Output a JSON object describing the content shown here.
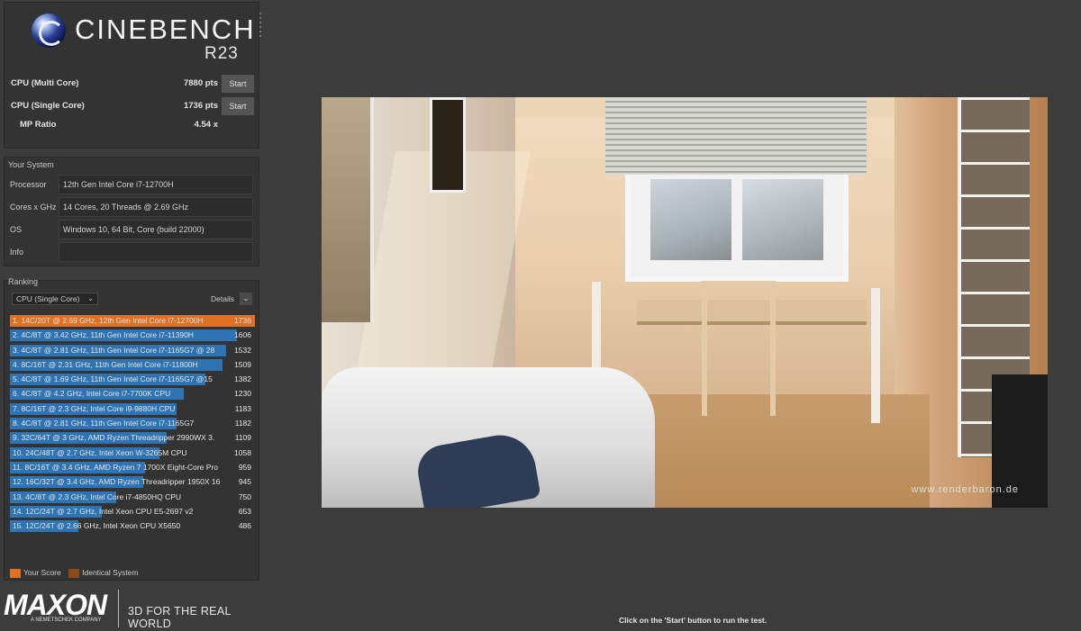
{
  "app": {
    "title": "CINEBENCH",
    "version": "R23"
  },
  "scores": {
    "multi": {
      "label": "CPU (Multi Core)",
      "value": "7880 pts",
      "button": "Start"
    },
    "single": {
      "label": "CPU (Single Core)",
      "value": "1736 pts",
      "button": "Start"
    },
    "ratio": {
      "label": "MP Ratio",
      "value": "4.54 x"
    }
  },
  "system": {
    "title": "Your System",
    "rows": [
      {
        "key": "Processor",
        "value": "12th Gen Intel Core i7-12700H"
      },
      {
        "key": "Cores x GHz",
        "value": "14 Cores, 20 Threads @ 2.69 GHz"
      },
      {
        "key": "OS",
        "value": "Windows 10, 64 Bit, Core (build 22000)"
      },
      {
        "key": "Info",
        "value": ""
      }
    ]
  },
  "ranking": {
    "title": "Ranking",
    "select": "CPU (Single Core)",
    "details_label": "Details",
    "max_score": 1736,
    "rows": [
      {
        "text": "1. 14C/20T @ 2.69 GHz, 12th Gen Intel Core i7-12700H",
        "score": 1736,
        "me": true
      },
      {
        "text": "2. 4C/8T @ 3.42 GHz, 11th Gen Intel Core i7-11390H",
        "score": 1606,
        "me": false
      },
      {
        "text": "3. 4C/8T @ 2.81 GHz, 11th Gen Intel Core i7-1165G7 @ 28",
        "score": 1532,
        "me": false
      },
      {
        "text": "4. 8C/16T @ 2.31 GHz, 11th Gen Intel Core i7-11800H",
        "score": 1509,
        "me": false
      },
      {
        "text": "5. 4C/8T @ 1.69 GHz, 11th Gen Intel Core i7-1165G7 @15",
        "score": 1382,
        "me": false
      },
      {
        "text": "6. 4C/8T @ 4.2 GHz, Intel Core i7-7700K CPU",
        "score": 1230,
        "me": false
      },
      {
        "text": "7. 8C/16T @ 2.3 GHz, Intel Core i9-9880H CPU",
        "score": 1183,
        "me": false
      },
      {
        "text": "8. 4C/8T @ 2.81 GHz, 11th Gen Intel Core i7-1165G7",
        "score": 1182,
        "me": false
      },
      {
        "text": "9. 32C/64T @ 3 GHz, AMD Ryzen Threadripper 2990WX 3.",
        "score": 1109,
        "me": false
      },
      {
        "text": "10. 24C/48T @ 2.7 GHz, Intel Xeon W-3265M CPU",
        "score": 1058,
        "me": false
      },
      {
        "text": "11. 8C/16T @ 3.4 GHz, AMD Ryzen 7 1700X Eight-Core Pro",
        "score": 959,
        "me": false
      },
      {
        "text": "12. 16C/32T @ 3.4 GHz, AMD Ryzen Threadripper 1950X 16",
        "score": 945,
        "me": false
      },
      {
        "text": "13. 4C/8T @ 2.3 GHz, Intel Core i7-4850HQ CPU",
        "score": 750,
        "me": false
      },
      {
        "text": "14. 12C/24T @ 2.7 GHz, Intel Xeon CPU E5-2697 v2",
        "score": 653,
        "me": false
      },
      {
        "text": "15. 12C/24T @ 2.66 GHz, Intel Xeon CPU X5650",
        "score": 486,
        "me": false
      }
    ],
    "legend": {
      "your_score": "Your Score",
      "identical": "Identical System"
    }
  },
  "colors": {
    "your_score": "#de7124",
    "identical_system": "#8a4a1c",
    "bar": "#2e74b4"
  },
  "branding": {
    "company": "MAXON",
    "subline": "A NEMETSCHEK COMPANY",
    "tagline": "3D FOR THE REAL WORLD"
  },
  "render": {
    "watermark": "www.renderbaron.de"
  },
  "status": "Click on the 'Start' button to run the test."
}
